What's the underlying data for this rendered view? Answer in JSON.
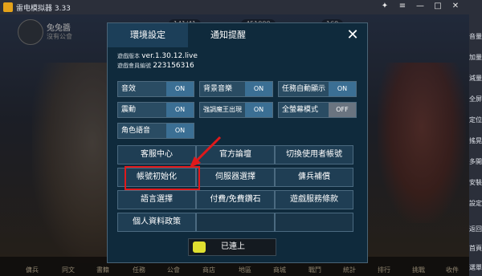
{
  "titlebar": {
    "title": "雷电模拟器 3.33"
  },
  "game": {
    "player_name": "兔兔醬",
    "player_status": "沒有公會",
    "resources": [
      "141/41",
      "451000",
      "160"
    ],
    "bottom_nav": [
      "傭兵",
      "同文",
      "書籍",
      "任務",
      "公會",
      "商店",
      "地區",
      "商城",
      "戰鬥",
      "統計",
      "排行",
      "挑戰",
      "收件"
    ]
  },
  "sidebar": [
    "音量",
    "加量",
    "減量",
    "全屏",
    "定位",
    "搖晃",
    "多開",
    "安裝",
    "設定",
    "返回",
    "首頁",
    "選單"
  ],
  "dialog": {
    "tabs": [
      "環境設定",
      "通知提醒"
    ],
    "version_label": "遊戲版本",
    "version_value": "ver.1.30.12.live",
    "member_label": "遊戲會員編號",
    "member_value": "223156316",
    "toggles": [
      {
        "label": "音效",
        "state": "ON"
      },
      {
        "label": "背景音樂",
        "state": "ON"
      },
      {
        "label": "任務自動顯示",
        "state": "ON"
      },
      {
        "label": "震動",
        "state": "ON"
      },
      {
        "label": "強調魔王出現",
        "state": "ON"
      },
      {
        "label": "全螢幕模式",
        "state": "OFF"
      },
      {
        "label": "角色語音",
        "state": "ON"
      }
    ],
    "buttons": [
      "客服中心",
      "官方論壇",
      "切換使用者帳號",
      "帳號初始化",
      "伺服器選擇",
      "傭兵補償",
      "語言選擇",
      "付費/免費鑽石",
      "遊戲服務條款",
      "個人資料政策",
      "",
      ""
    ],
    "connect_label": "已連上"
  },
  "colors": {
    "highlight": "#e0191b",
    "toggle_on": "#3b6f94",
    "toggle_off": "#6a7480"
  }
}
